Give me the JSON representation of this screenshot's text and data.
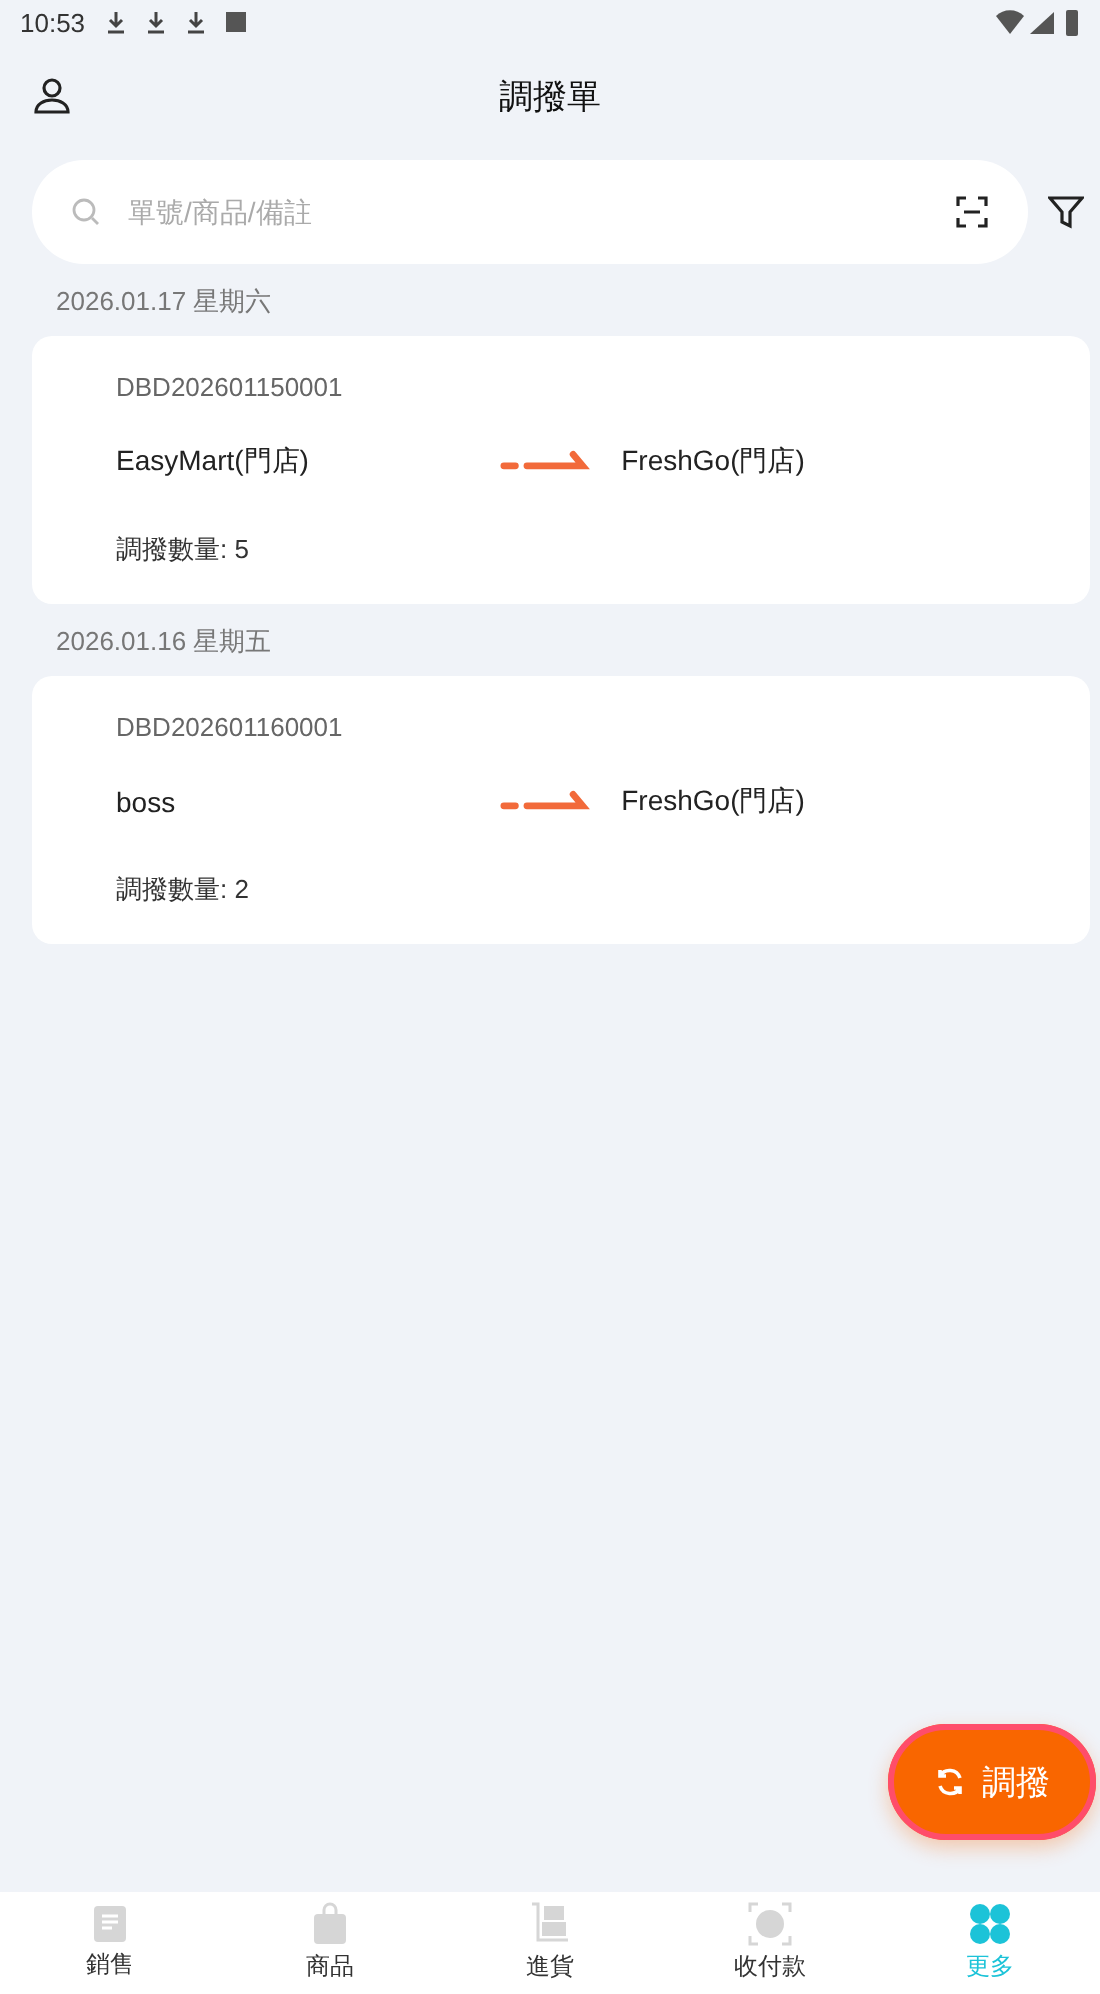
{
  "status_bar": {
    "time": "10:53"
  },
  "header": {
    "title": "調撥單"
  },
  "search": {
    "placeholder": "單號/商品/備註"
  },
  "groups": [
    {
      "date": "2026.01.17 星期六",
      "orders": [
        {
          "number": "DBD202601150001",
          "from": "EasyMart(門店)",
          "to": "FreshGo(門店)",
          "quantity": "調撥數量: 5"
        }
      ]
    },
    {
      "date": "2026.01.16 星期五",
      "orders": [
        {
          "number": "DBD202601160001",
          "from": "boss",
          "to": "FreshGo(門店)",
          "quantity": "調撥數量: 2"
        }
      ]
    }
  ],
  "fab": {
    "label": "調撥",
    "highlighted": true
  },
  "nav": [
    {
      "label": "銷售",
      "kind": "doc",
      "selected": false
    },
    {
      "label": "商品",
      "kind": "bag",
      "selected": false
    },
    {
      "label": "進貨",
      "kind": "cart",
      "selected": false
    },
    {
      "label": "收付款",
      "kind": "pay",
      "selected": false
    },
    {
      "label": "更多",
      "kind": "more",
      "selected": true
    }
  ]
}
